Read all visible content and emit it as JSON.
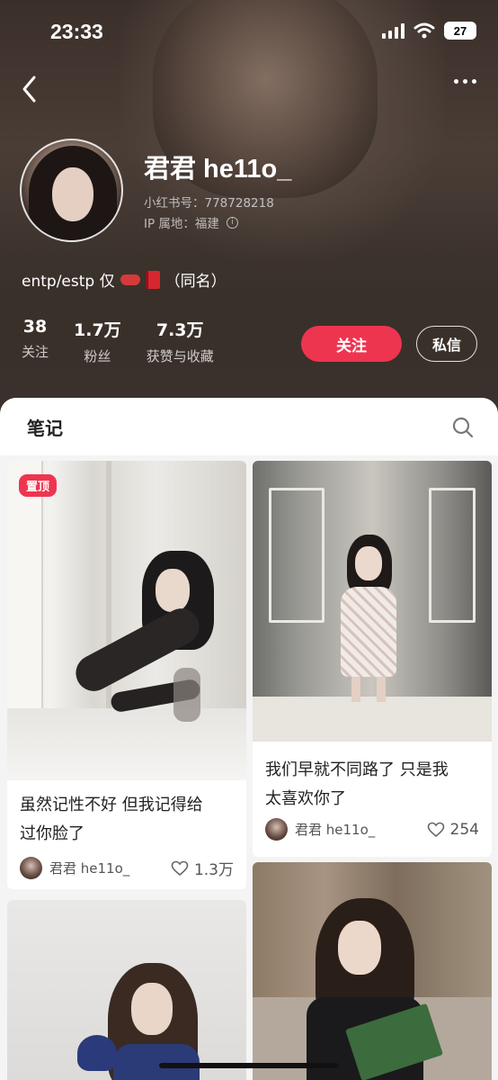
{
  "status": {
    "time": "23:33",
    "battery": "27"
  },
  "profile": {
    "name": "君君 he11o_",
    "redbook_id": "小红书号：778728218",
    "ip_location": "IP 属地：福建",
    "bio_prefix": "entp/estp 仅",
    "bio_suffix": "（同名）"
  },
  "stats": [
    {
      "value": "38",
      "label": "关注"
    },
    {
      "value": "1.7万",
      "label": "粉丝"
    },
    {
      "value": "7.3万",
      "label": "获赞与收藏"
    }
  ],
  "actions": {
    "follow": "关注",
    "message": "私信"
  },
  "tabs": {
    "notes": "笔记"
  },
  "notes": [
    {
      "pinned_label": "置顶",
      "title_line1": "虽然记性不好 但我记得给",
      "title_line2": "过你脸了",
      "author": "君君 he11o_",
      "likes": "1.3万"
    },
    {
      "title_line1": "我们早就不同路了 只是我",
      "title_line2": "太喜欢你了",
      "author": "君君 he11o_",
      "likes": "254"
    }
  ],
  "colors": {
    "accent": "#ee3550",
    "header_bg": "#3b2f2a"
  }
}
